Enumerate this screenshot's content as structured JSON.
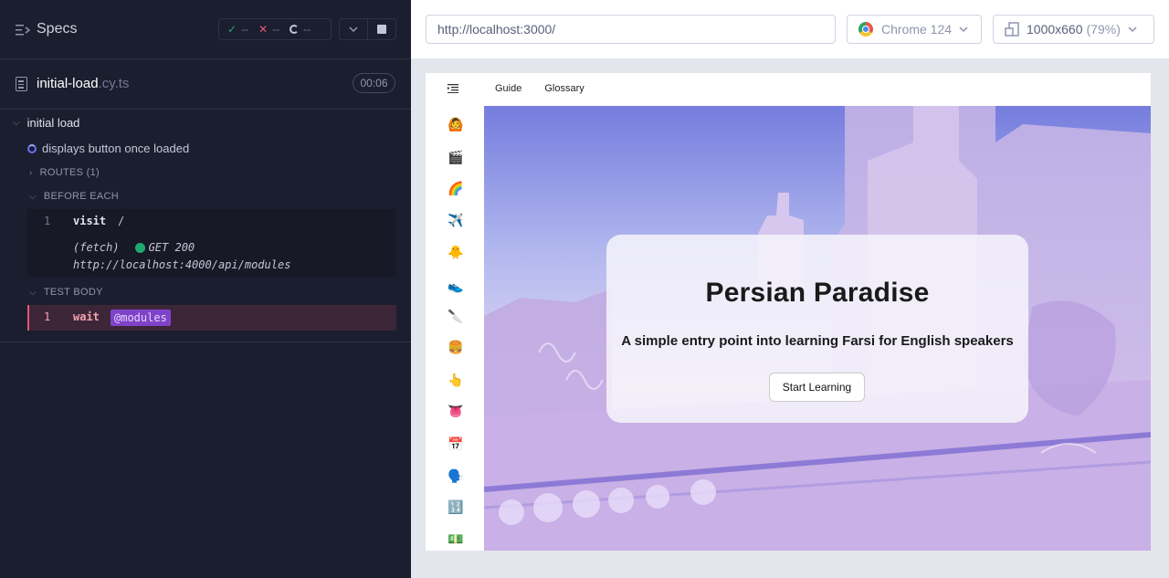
{
  "reporter": {
    "specs_label": "Specs",
    "stats": {
      "passed": "--",
      "failed": "--",
      "pending": "--"
    },
    "file": {
      "name": "initial-load",
      "ext": ".cy.ts",
      "time": "00:06"
    },
    "suite": "initial load",
    "test": "displays button once loaded",
    "routes_label": "ROUTES (1)",
    "before_each_label": "BEFORE EACH",
    "test_body_label": "TEST BODY",
    "commands": {
      "visit": {
        "num": "1",
        "name": "visit",
        "arg": "/"
      },
      "fetch": {
        "label": "(fetch)",
        "method_status": "GET 200",
        "url": "http://localhost:4000/api/modules"
      },
      "wait": {
        "num": "1",
        "name": "wait",
        "alias": "@modules"
      }
    },
    "colors": {
      "pass": "#1fa971",
      "fail": "#e45770",
      "alias": "#7f43c9"
    }
  },
  "aut": {
    "url": "http://localhost:3000/",
    "browser": "Chrome 124",
    "viewport": "1000x660",
    "zoom": "(79%)"
  },
  "app": {
    "nav": [
      "Guide",
      "Glossary"
    ],
    "sidebar_icons": [
      "🙆",
      "🎬",
      "🌈",
      "✈️",
      "🐥",
      "👟",
      "🔪",
      "🍔",
      "👆",
      "👅",
      "📅",
      "🗣️",
      "🔢",
      "💵"
    ],
    "hero": {
      "title": "Persian Paradise",
      "subtitle": "A simple entry point into learning Farsi for English speakers",
      "button": "Start Learning"
    }
  }
}
